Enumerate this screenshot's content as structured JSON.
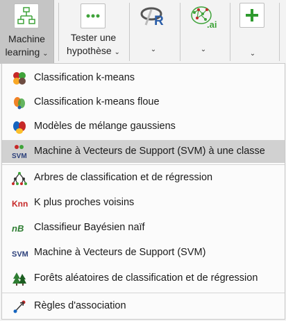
{
  "ribbon": {
    "machine_learning": {
      "line1": "Machine",
      "line2": "learning",
      "chevron": "⌄",
      "icon": "network-icon"
    },
    "tester": {
      "line1": "Tester une",
      "line2": "hypothèse",
      "chevron": "⌄",
      "icon": "dots-icon"
    },
    "r_button": {
      "chevron": "⌄",
      "icon": "r-icon"
    },
    "ai_button": {
      "chevron": "⌄",
      "icon": "ai-brain-icon",
      "label": ".ai"
    },
    "add_button": {
      "chevron": "⌄",
      "icon": "plus-icon"
    }
  },
  "menu": {
    "items": [
      {
        "label": "Classification k-means",
        "icon": "kmeans-icon"
      },
      {
        "label": "Classification k-means floue",
        "icon": "fuzzy-kmeans-icon"
      },
      {
        "label": "Modèles de mélange gaussiens",
        "icon": "gaussian-mixture-icon"
      },
      {
        "label": "Machine à Vecteurs de Support (SVM) à une classe",
        "icon": "svm-one-class-icon",
        "icon_text": "SVM"
      },
      {
        "label": "Arbres de classification et de régression",
        "icon": "tree-icon"
      },
      {
        "label": "K plus proches voisins",
        "icon": "knn-icon",
        "icon_text": "Knn"
      },
      {
        "label": "Classifieur Bayésien naïf",
        "icon": "naive-bayes-icon",
        "icon_text": "nB"
      },
      {
        "label": "Machine à Vecteurs de Support (SVM)",
        "icon": "svm-icon",
        "icon_text": "SVM"
      },
      {
        "label": "Forêts aléatoires de classification et de régression",
        "icon": "random-forest-icon"
      },
      {
        "label": "Règles d'association",
        "icon": "association-rules-icon"
      }
    ]
  },
  "colors": {
    "highlight": "#d1d1d1",
    "green": "#3fa33a",
    "red": "#c62828",
    "blue": "#2b5ea8"
  }
}
